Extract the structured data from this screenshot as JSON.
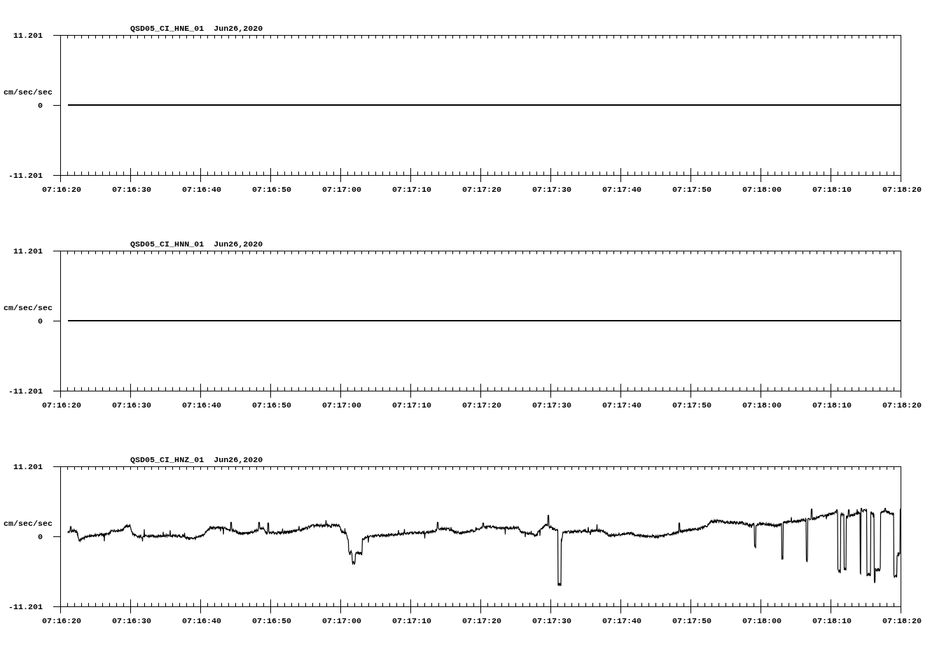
{
  "panels": [
    {
      "title": "QSD05_CI_HNE_01  Jun26,2020",
      "y_unit": "cm/sec/sec",
      "y_ticks": [
        "11.201",
        "0",
        "-11.201"
      ],
      "x_ticks": [
        "07:16:20",
        "07:16:30",
        "07:16:40",
        "07:16:50",
        "07:17:00",
        "07:17:10",
        "07:17:20",
        "07:17:30",
        "07:17:40",
        "07:17:50",
        "07:18:00",
        "07:18:10",
        "07:18:20"
      ],
      "trace": {
        "kind": "flat"
      }
    },
    {
      "title": "QSD05_CI_HNN_01  Jun26,2020",
      "y_unit": "cm/sec/sec",
      "y_ticks": [
        "11.201",
        "0",
        "-11.201"
      ],
      "x_ticks": [
        "07:16:20",
        "07:16:30",
        "07:16:40",
        "07:16:50",
        "07:17:00",
        "07:17:10",
        "07:17:20",
        "07:17:30",
        "07:17:40",
        "07:17:50",
        "07:18:00",
        "07:18:10",
        "07:18:20"
      ],
      "trace": {
        "kind": "flat"
      }
    },
    {
      "title": "QSD05_CI_HNZ_01  Jun26,2020",
      "y_unit": "cm/sec/sec",
      "y_ticks": [
        "11.201",
        "0",
        "-11.201"
      ],
      "x_ticks": [
        "07:16:20",
        "07:16:30",
        "07:16:40",
        "07:16:50",
        "07:17:00",
        "07:17:10",
        "07:17:20",
        "07:17:30",
        "07:17:40",
        "07:17:50",
        "07:18:00",
        "07:18:10",
        "07:18:20"
      ],
      "trace": {
        "kind": "waveform"
      }
    }
  ]
}
